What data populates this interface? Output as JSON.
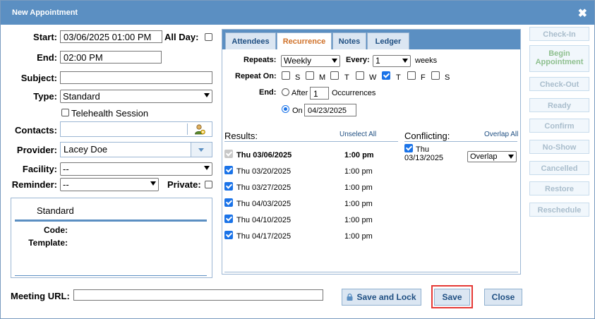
{
  "dialog": {
    "title": "New Appointment"
  },
  "form": {
    "start_label": "Start:",
    "start_value": "03/06/2025 01:00 PM",
    "all_day_label": "All Day:",
    "end_label": "End:",
    "end_value": "02:00 PM",
    "subject_label": "Subject:",
    "subject_value": "",
    "type_label": "Type:",
    "type_value": "Standard",
    "telehealth_label": "Telehealth Session",
    "contacts_label": "Contacts:",
    "contacts_value": "",
    "provider_label": "Provider:",
    "provider_value": "Lacey Doe",
    "facility_label": "Facility:",
    "facility_value": "--",
    "reminder_label": "Reminder:",
    "reminder_value": "--",
    "private_label": "Private:",
    "meeting_url_label": "Meeting URL:",
    "meeting_url_value": ""
  },
  "type_box": {
    "title": "Standard",
    "code_label": "Code:",
    "template_label": "Template:"
  },
  "tabs": [
    {
      "label": "Attendees"
    },
    {
      "label": "Recurrence"
    },
    {
      "label": "Notes"
    },
    {
      "label": "Ledger"
    }
  ],
  "recurrence": {
    "repeats_label": "Repeats:",
    "repeats_value": "Weekly",
    "every_label": "Every:",
    "every_value": "1",
    "weeks_label": "weeks",
    "repeat_on_label": "Repeat On:",
    "days": [
      {
        "label": "S",
        "checked": false
      },
      {
        "label": "M",
        "checked": false
      },
      {
        "label": "T",
        "checked": false
      },
      {
        "label": "W",
        "checked": false
      },
      {
        "label": "T",
        "checked": true
      },
      {
        "label": "F",
        "checked": false
      },
      {
        "label": "S",
        "checked": false
      }
    ],
    "end_label": "End:",
    "after_label": "After",
    "after_value": "1",
    "occurrences_label": "Occurrences",
    "on_label": "On",
    "on_value": "04/23/2025"
  },
  "results": {
    "title": "Results:",
    "unselect_all": "Unselect All",
    "rows": [
      {
        "date": "Thu 03/06/2025",
        "time": "1:00 pm"
      },
      {
        "date": "Thu 03/20/2025",
        "time": "1:00 pm"
      },
      {
        "date": "Thu 03/27/2025",
        "time": "1:00 pm"
      },
      {
        "date": "Thu 04/03/2025",
        "time": "1:00 pm"
      },
      {
        "date": "Thu 04/10/2025",
        "time": "1:00 pm"
      },
      {
        "date": "Thu 04/17/2025",
        "time": "1:00 pm"
      }
    ]
  },
  "conflicting": {
    "title": "Conflicting:",
    "overlap_all": "Overlap All",
    "item_day": "Thu",
    "item_date": "03/13/2025",
    "item_action": "Overlap"
  },
  "status_buttons": [
    {
      "label": "Check-In"
    },
    {
      "label": "Begin Appointment"
    },
    {
      "label": "Check-Out"
    },
    {
      "label": "Ready"
    },
    {
      "label": "Confirm"
    },
    {
      "label": "No-Show"
    },
    {
      "label": "Cancelled"
    },
    {
      "label": "Restore"
    },
    {
      "label": "Reschedule"
    }
  ],
  "footer": {
    "save_lock": "Save and Lock",
    "save": "Save",
    "close": "Close"
  },
  "colors": {
    "header": "#5b8fc2",
    "tab_active_text": "#d0722a",
    "highlight_border": "#e53935"
  }
}
